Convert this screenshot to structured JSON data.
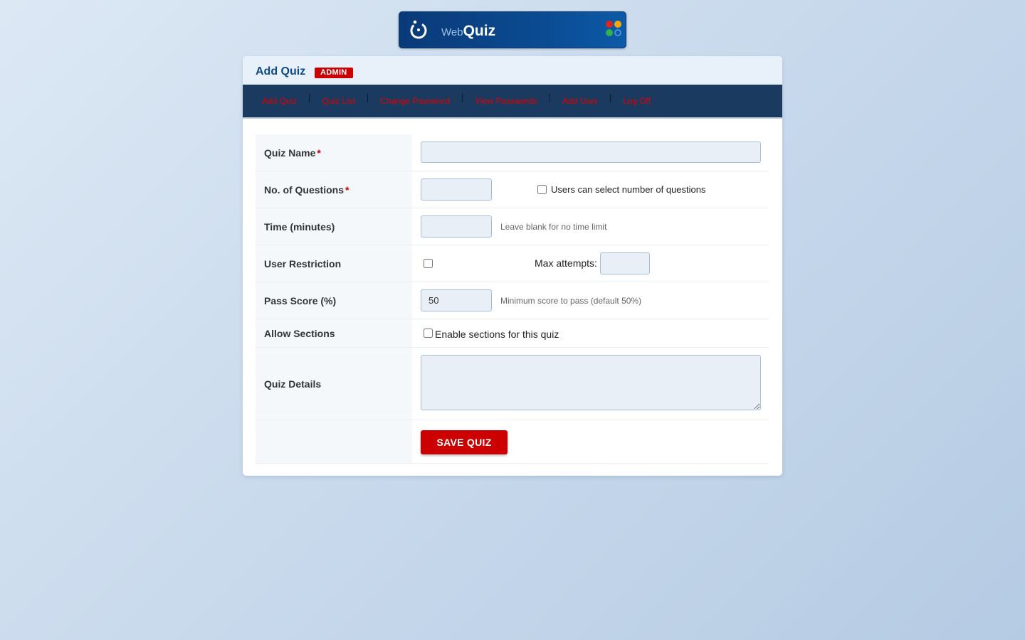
{
  "logo": {
    "text_web": "Web",
    "text_quiz": "Quiz",
    "colors": [
      "#e1251b",
      "#f6a800",
      "#2fb34a",
      "#4a90d9"
    ]
  },
  "header": {
    "title": "Add Quiz",
    "badge": "ADMIN"
  },
  "nav": {
    "items": [
      {
        "label": "Add Quiz"
      },
      {
        "label": "Quiz List"
      },
      {
        "label": "Change Password"
      },
      {
        "label": "View Passwords"
      },
      {
        "label": "Add User"
      },
      {
        "label": "Log Off"
      }
    ],
    "link_color": "#e10000",
    "bar_color": "#1b3a5f"
  },
  "form": {
    "quiz_name": {
      "label": "Quiz Name",
      "required_mark": "*",
      "value": ""
    },
    "num_questions": {
      "label": "No. of Questions",
      "required_mark": "*",
      "value": "",
      "checkbox_label": "Users can select number of questions",
      "checked": false
    },
    "time": {
      "label": "Time (minutes)",
      "value": "",
      "hint": "Leave blank for no time limit"
    },
    "user_restriction": {
      "label": "User Restriction",
      "checked": false,
      "max_attempts_label": "Max attempts:",
      "max_attempts_value": ""
    },
    "pass_score": {
      "label": "Pass Score (%)",
      "value": "50",
      "hint": "Minimum score to pass (default 50%)"
    },
    "allow_sections": {
      "label": "Allow Sections",
      "checkbox_label": "Enable sections for this quiz",
      "checked": false
    },
    "quiz_details": {
      "label": "Quiz Details",
      "value": ""
    },
    "save_label": "SAVE QUIZ"
  },
  "accent_color": "#cc0000"
}
